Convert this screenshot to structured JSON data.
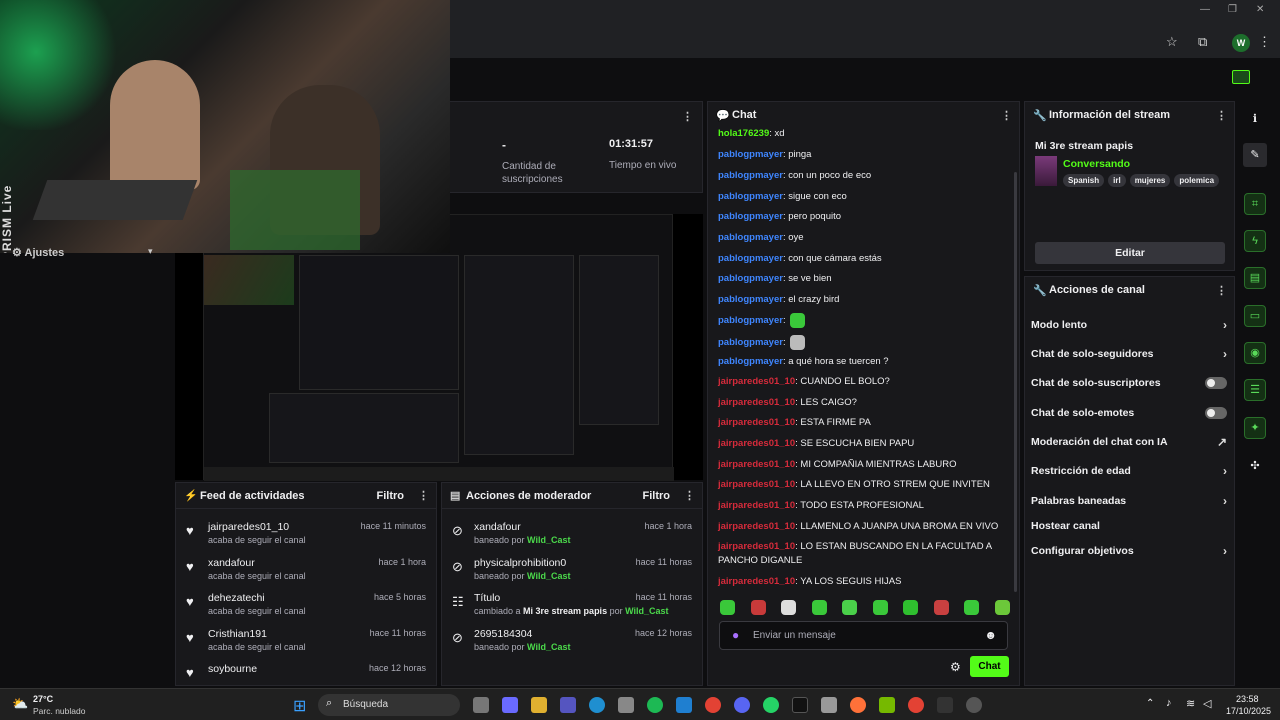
{
  "browser": {
    "profile_initial": "W"
  },
  "overlay": {
    "prism_label": "PRISM Live",
    "ajustes_label": "Ajustes"
  },
  "stats": {
    "subs_value": "-",
    "subs_label": "Cantidad de suscripciones",
    "time_value": "01:31:57",
    "time_label": "Tiempo en vivo"
  },
  "chat": {
    "title": "Chat",
    "messages": [
      {
        "user": "hola176239",
        "text": ": xd"
      },
      {
        "user": "pablogpmayer",
        "text": ": pinga"
      },
      {
        "user": "pablogpmayer",
        "text": ": con un poco de eco"
      },
      {
        "user": "pablogpmayer",
        "text": ": sigue con eco"
      },
      {
        "user": "pablogpmayer",
        "text": ": pero poquito"
      },
      {
        "user": "pablogpmayer",
        "text": ": oye"
      },
      {
        "user": "pablogpmayer",
        "text": ": con que cámara estás"
      },
      {
        "user": "pablogpmayer",
        "text": ": se ve bien"
      },
      {
        "user": "pablogpmayer",
        "text": ": el crazy bird"
      },
      {
        "user": "pablogpmayer",
        "text": ":"
      },
      {
        "user": "pablogpmayer",
        "text": ":"
      },
      {
        "user": "pablogpmayer",
        "text": ": a qué hora se tuercen ?"
      },
      {
        "user": "jairparedes01_10",
        "text": ": CUANDO EL BOLO?"
      },
      {
        "user": "jairparedes01_10",
        "text": ": LES CAIGO?"
      },
      {
        "user": "jairparedes01_10",
        "text": ": ESTA FIRME PA"
      },
      {
        "user": "jairparedes01_10",
        "text": ": SE ESCUCHA BIEN PAPU"
      },
      {
        "user": "jairparedes01_10",
        "text": ": MI COMPAÑIA MIENTRAS LABURO"
      },
      {
        "user": "jairparedes01_10",
        "text": ": LA LLEVO EN OTRO STREM QUE INVITEN"
      },
      {
        "user": "jairparedes01_10",
        "text": ": TODO ESTA PROFESIONAL"
      },
      {
        "user": "jairparedes01_10",
        "text": ": LLAMENLO A JUANPA UNA BROMA EN VIVO"
      },
      {
        "user": "jairparedes01_10",
        "text": ": LO ESTAN BUSCANDO EN LA FACULTAD A"
      },
      {
        "user": "",
        "text": "PANCHO DIGANLE"
      },
      {
        "user": "jairparedes01_10",
        "text": ": YA LOS SEGUIS HIJAS"
      }
    ],
    "input_placeholder": "Enviar un mensaje",
    "send_label": "Chat"
  },
  "stream_info": {
    "title": "Información del stream",
    "stream_title": "Mi 3re stream papis",
    "category": "Conversando",
    "tags": [
      "Spanish",
      "irl",
      "mujeres",
      "polemica"
    ],
    "edit_label": "Editar"
  },
  "channel_actions": {
    "title": "Acciones de canal",
    "items": [
      "Modo lento",
      "Chat de solo-seguidores",
      "Chat de solo-suscriptores",
      "Chat de solo-emotes",
      "Moderación del chat con IA",
      "Restricción de edad",
      "Palabras baneadas",
      "Hostear canal",
      "Configurar objetivos"
    ]
  },
  "feed": {
    "title": "Feed de actividades",
    "filter_label": "Filtro",
    "items": [
      {
        "name": "jairparedes01_10",
        "sub": "acaba de seguir el canal",
        "time": "hace 11 minutos"
      },
      {
        "name": "xandafour",
        "sub": "acaba de seguir el canal",
        "time": "hace 1 hora"
      },
      {
        "name": "dehezatechi",
        "sub": "acaba de seguir el canal",
        "time": "hace 5 horas"
      },
      {
        "name": "Cristhian191",
        "sub": "acaba de seguir el canal",
        "time": "hace 11 horas"
      },
      {
        "name": "soybourne",
        "sub": "",
        "time": "hace 12 horas"
      }
    ]
  },
  "mod": {
    "title": "Acciones de moderador",
    "filter_label": "Filtro",
    "items": [
      {
        "name": "xandafour",
        "pre": "baneado por ",
        "by": "Wild_Cast",
        "time": "hace 1 hora"
      },
      {
        "name": "physicalprohibition0",
        "pre": "baneado por ",
        "by": "Wild_Cast",
        "time": "hace 11 horas"
      },
      {
        "name": "Título",
        "pre": "cambiado a ",
        "mid": "Mi 3re stream papis",
        "post": " por ",
        "by": "Wild_Cast",
        "time": "hace 11 horas"
      },
      {
        "name": "2695184304",
        "pre": "baneado por ",
        "by": "Wild_Cast",
        "time": "hace 12 horas"
      }
    ]
  },
  "taskbar": {
    "temp": "27°C",
    "weather": "Parc. nublado",
    "search": "Búsqueda",
    "time": "23:58",
    "date": "17/10/2025"
  },
  "colors": {
    "accent": "#53fc18",
    "bg": "#0e0e10",
    "panel": "#18181b",
    "user_blue": "#3f86ff",
    "user_red": "#d62b3b"
  }
}
